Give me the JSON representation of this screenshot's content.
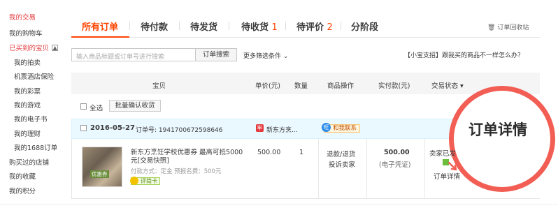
{
  "sidebar": {
    "items": [
      {
        "label": "我的交易",
        "red": true
      },
      {
        "label": "我的购物车"
      },
      {
        "label": "已买到的宝贝",
        "red": true,
        "toggle": "▲"
      },
      {
        "label": "我的拍卖"
      },
      {
        "label": "机票酒店保险"
      },
      {
        "label": "我的彩票"
      },
      {
        "label": "我的游戏"
      },
      {
        "label": "我的电子书"
      },
      {
        "label": "我的理财"
      },
      {
        "label": "我的1688订单"
      },
      {
        "label": "购买过的店铺"
      },
      {
        "label": "我的收藏"
      },
      {
        "label": "我的积分"
      }
    ]
  },
  "tabs": [
    {
      "label": "所有订单",
      "count": ""
    },
    {
      "label": "待付款",
      "count": ""
    },
    {
      "label": "待发货",
      "count": ""
    },
    {
      "label": "待收货",
      "count": "1"
    },
    {
      "label": "待评价",
      "count": "2"
    },
    {
      "label": "分阶段",
      "count": ""
    }
  ],
  "recycle": "订单回收站",
  "search": {
    "placeholder": "输入商品标题或订单号进行搜索",
    "button": "订单搜索",
    "more": "更多筛选条件 ⌄"
  },
  "help_link": "【小宝支招】跟我买的商品不一样怎么办？",
  "table_headers": [
    "宝贝",
    "单价(元)",
    "数量",
    "商品操作",
    "实付款(元)",
    "交易状态 ▾"
  ],
  "select_all": "全选",
  "batch_confirm": "批量确认收货",
  "order": {
    "date": "2016-05-27",
    "number": "订单号: 1941700672598646",
    "shop_icon": "牢",
    "shop": "新东方烹...",
    "contact_icon": "旺",
    "contact": "和我联系",
    "thumb_label": "优惠券",
    "title": "新东方烹饪学校优惠券 最高可抵5000元[交易快照]",
    "meta": "付款方式：定金    预报名费：500元",
    "badge": "评简卡",
    "unit_price": "500.00",
    "quantity": "1",
    "ops": [
      "退款/退货",
      "投诉卖家"
    ],
    "paid": "500.00",
    "paid_note": "(电子凭证)",
    "status": "卖家已发",
    "detail": "订单详情"
  },
  "zoom_text": "订单详情",
  "colors": {
    "accent": "#f40",
    "red": "#e4393c",
    "circle": "#f25d54",
    "order_head_bg": "#eaf8ff"
  }
}
